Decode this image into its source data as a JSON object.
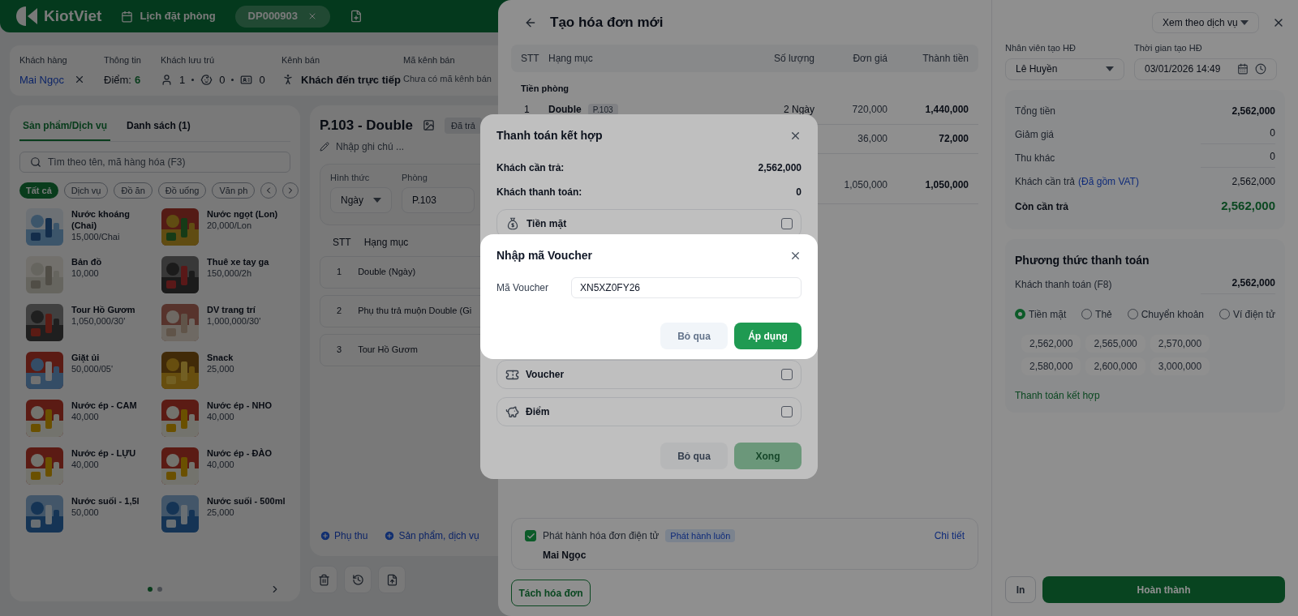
{
  "header": {
    "logo": "KiotViet",
    "nav_link": "Lịch đặt phòng",
    "booking_tab": "DP000903"
  },
  "booking_info": [
    {
      "kind": "customer",
      "label": "Khách hàng",
      "value": "Mai Ngọc"
    },
    {
      "kind": "points",
      "label": "Thông tin",
      "prefix": "Điểm:",
      "value": "6"
    },
    {
      "kind": "guests",
      "label": "Khách lưu trú",
      "counts": [
        "1",
        "0",
        "0"
      ]
    },
    {
      "kind": "channel",
      "label": "Kênh bán",
      "value": "Khách đến trực tiếp"
    },
    {
      "kind": "empty",
      "label": "Mã kênh bán",
      "value": "Chưa có mã kênh bán"
    }
  ],
  "products": {
    "tabs": [
      {
        "label": "Sản phẩm/Dịch vụ",
        "selected": true
      },
      {
        "label": "Danh sách (1)",
        "selected": false
      }
    ],
    "search": {
      "placeholder": "Tìm theo tên, mã hàng hóa (F3)"
    },
    "categories": [
      {
        "label": "Tất cả",
        "selected": true
      },
      {
        "label": "Dịch vụ",
        "selected": false
      },
      {
        "label": "Đồ ăn",
        "selected": false
      },
      {
        "label": "Đồ uống",
        "selected": false
      },
      {
        "label": "Văn ph",
        "selected": false
      }
    ],
    "items": [
      {
        "name": "Nước khoáng (Chai)",
        "price": "15,000/Chai"
      },
      {
        "name": "Nước ngọt (Lon)",
        "price": "20,000/Lon"
      },
      {
        "name": "Bản đồ",
        "price": "10,000"
      },
      {
        "name": "Thuê xe tay ga",
        "price": "150,000/2h"
      },
      {
        "name": "Tour Hồ Gươm",
        "price": "1,050,000/30'"
      },
      {
        "name": "DV trang trí",
        "price": "1,000,000/30'"
      },
      {
        "name": "Giặt ủi",
        "price": "50,000/05'"
      },
      {
        "name": "Snack",
        "price": "25,000"
      },
      {
        "name": "Nước ép - CAM",
        "price": "40,000"
      },
      {
        "name": "Nước ép - NHO",
        "price": "40,000"
      },
      {
        "name": "Nước ép - LỰU",
        "price": "40,000"
      },
      {
        "name": "Nước ép - ĐÀO",
        "price": "40,000"
      },
      {
        "name": "Nước suối - 1,5l",
        "price": "50,000"
      },
      {
        "name": "Nước suối - 500ml",
        "price": "25,000"
      }
    ],
    "pages": [
      {
        "selected": true
      },
      {
        "selected": false
      }
    ]
  },
  "room": {
    "title": "P.103 - Double",
    "status": "Đã trả",
    "note_placeholder": "Nhập ghi chú ...",
    "fields": [
      {
        "kind": "select",
        "label": "Hình thức",
        "value": "Ngày"
      },
      {
        "kind": "text",
        "label": "Phòng",
        "value": "P.103"
      }
    ],
    "columns": [
      "STT",
      "Hạng mục"
    ],
    "rows": [
      {
        "stt": "1",
        "name": "Double (Ngày)"
      },
      {
        "stt": "2",
        "name": "Phụ thu trả muộn Double (Gi"
      },
      {
        "stt": "3",
        "name": "Tour Hồ Gươm"
      }
    ],
    "add_links": [
      "Phụ thu",
      "Sản phẩm, dịch vụ"
    ]
  },
  "invoice": {
    "title": "Tạo hóa đơn mới",
    "view_select": "Xem theo dịch vụ",
    "columns": [
      "STT",
      "Hạng mục",
      "Số lượng",
      "Đơn giá",
      "Thành tiền"
    ],
    "group": "Tiền phòng",
    "rows": [
      {
        "stt": "1",
        "name": "Double",
        "tag": "P.103",
        "qty": "2 Ngày",
        "price": "720,000",
        "total": "1,440,000"
      },
      {
        "price": "36,000",
        "total": "72,000"
      },
      {
        "price": "1,050,000",
        "total": "1,050,000"
      }
    ],
    "e_invoice": {
      "checked": true,
      "label": "Phát hành hóa đơn điện tử",
      "badge": "Phát hành luôn",
      "link": "Chi tiết",
      "customer": "Mai Ngọc"
    },
    "split_button": "Tách hóa đơn",
    "staff": {
      "label": "Nhân viên tạo HĐ",
      "value": "Lê Huyền"
    },
    "created_time": {
      "label": "Thời gian tạo HĐ",
      "value": "03/01/2026 14:49"
    },
    "summary": [
      {
        "kind": "strong",
        "label": "Tổng tiền",
        "value": "2,562,000"
      },
      {
        "kind": "input",
        "label": "Giảm giá",
        "value": "0"
      },
      {
        "kind": "input",
        "label": "Thu khác",
        "value": "0"
      },
      {
        "kind": "plain",
        "label": "Khách cần trả",
        "note": "(Đã gồm VAT)",
        "value": "2,562,000"
      },
      {
        "kind": "total",
        "label": "Còn cần trả",
        "value": "2,562,000"
      }
    ],
    "payment": {
      "title": "Phương thức thanh toán",
      "paid_label": "Khách thanh toán (F8)",
      "paid_value": "2,562,000",
      "methods": [
        {
          "label": "Tiền mặt",
          "selected": true
        },
        {
          "label": "Thẻ",
          "selected": false
        },
        {
          "label": "Chuyển khoản",
          "selected": false
        },
        {
          "label": "Ví điện tử",
          "selected": false
        }
      ],
      "quick_amounts": [
        "2,562,000",
        "2,565,000",
        "2,570,000",
        "2,580,000",
        "2,600,000",
        "3,000,000"
      ],
      "combined_link": "Thanh toán kết hợp"
    },
    "footer": {
      "print": "In",
      "complete": "Hoàn thành"
    }
  },
  "combined_payment": {
    "title": "Thanh toán kết hợp",
    "rows": [
      {
        "label": "Khách cần trả:",
        "value": "2,562,000"
      },
      {
        "label": "Khách thanh toán:",
        "value": "0"
      }
    ],
    "methods": [
      {
        "kind": "cash",
        "label": "Tiền mặt",
        "checked": false
      },
      {
        "kind": "voucher",
        "label": "Voucher",
        "checked": false
      },
      {
        "kind": "points",
        "label": "Điểm",
        "checked": false
      }
    ],
    "cancel": "Bỏ qua",
    "done": {
      "label": "Xong",
      "disabled": true
    }
  },
  "voucher_dialog": {
    "title": "Nhập mã Voucher",
    "label": "Mã Voucher",
    "value": "XN5XZ0FY26",
    "cancel": "Bỏ qua",
    "apply": "Áp dụng"
  }
}
